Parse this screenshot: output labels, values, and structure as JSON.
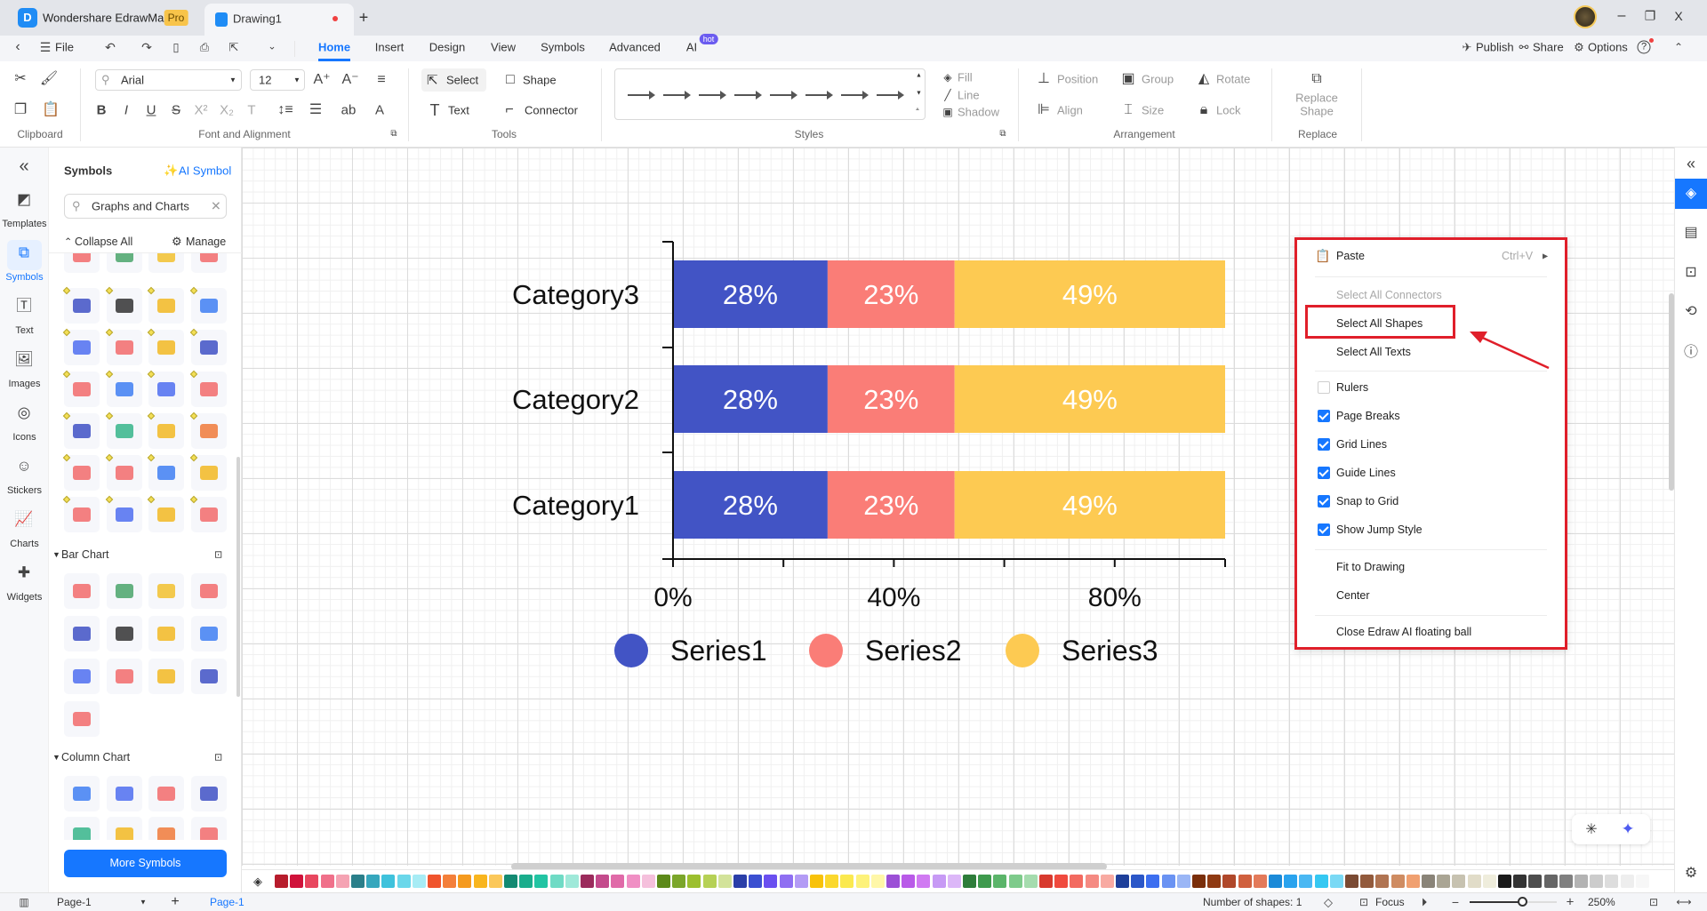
{
  "titlebar": {
    "app_name": "Wondershare EdrawMax",
    "pro_badge": "Pro",
    "doc_tab": "Drawing1",
    "new_tab": "+",
    "window": {
      "minimize": "–",
      "maximize": "❐",
      "close": "X"
    }
  },
  "menubar": {
    "file": "File",
    "tabs": [
      "Home",
      "Insert",
      "Design",
      "View",
      "Symbols",
      "Advanced",
      "AI"
    ],
    "active_tab": "Home",
    "hot_badge": "hot",
    "publish": "Publish",
    "share": "Share",
    "options": "Options",
    "help": "?"
  },
  "ribbon": {
    "groups": {
      "clipboard": "Clipboard",
      "font": "Font and Alignment",
      "tools": "Tools",
      "styles": "Styles",
      "arrangement": "Arrangement",
      "replace": "Replace"
    },
    "font_name": "Arial",
    "font_size": "12",
    "format_buttons": [
      "B",
      "I",
      "U",
      "S",
      "X²",
      "X₂",
      "T",
      "ab",
      "A"
    ],
    "tools": {
      "select": "Select",
      "shape": "Shape",
      "text": "Text",
      "connector": "Connector"
    },
    "style_props": {
      "fill": "Fill",
      "line": "Line",
      "shadow": "Shadow"
    },
    "arrangement": {
      "position": "Position",
      "group": "Group",
      "rotate": "Rotate",
      "align": "Align",
      "size": "Size",
      "lock": "Lock"
    },
    "replace_shape": [
      "Replace",
      "Shape"
    ]
  },
  "leftnav": {
    "items": [
      {
        "label": "Templates",
        "icon": "templates-icon"
      },
      {
        "label": "Symbols",
        "icon": "symbols-icon",
        "active": true
      },
      {
        "label": "Text",
        "icon": "text-icon"
      },
      {
        "label": "Images",
        "icon": "images-icon"
      },
      {
        "label": "Icons",
        "icon": "icons-icon"
      },
      {
        "label": "Stickers",
        "icon": "stickers-icon"
      },
      {
        "label": "Charts",
        "icon": "charts-icon"
      },
      {
        "label": "Widgets",
        "icon": "widgets-icon"
      }
    ]
  },
  "panel": {
    "title": "Symbols",
    "ai_symbol": "AI Symbol",
    "search_value": "Graphs and Charts",
    "collapse_all": "Collapse All",
    "manage": "Manage",
    "sections": [
      "Bar Chart",
      "Column Chart"
    ],
    "more_symbols": "More Symbols",
    "tile_colors": [
      "#f26b6b",
      "#4aa56a",
      "#f2c12e",
      "#f26b6b",
      "#3f51c4",
      "#333333",
      "#f2b822",
      "#3f7ff2",
      "#4f6ef0",
      "#f26b6b",
      "#f2b822",
      "#3f51c4",
      "#f26b6b",
      "#3f7ff2",
      "#4f6ef0",
      "#f26b6b",
      "#3f51c4",
      "#36b58a",
      "#f2b822",
      "#f07a3a",
      "#f26b6b",
      "#f26b6b",
      "#3f7ff2",
      "#f2b822",
      "#f26b6b",
      "#4f6ef0",
      "#f2b822",
      "#f26b6b"
    ]
  },
  "chart_data": {
    "type": "bar",
    "orientation": "horizontal",
    "stacked": true,
    "categories": [
      "Category1",
      "Category2",
      "Category3"
    ],
    "series": [
      {
        "name": "Series1",
        "values": [
          28,
          28,
          28
        ],
        "color": "#4254c5"
      },
      {
        "name": "Series2",
        "values": [
          23,
          23,
          23
        ],
        "color": "#fa7d77"
      },
      {
        "name": "Series3",
        "values": [
          49,
          49,
          49
        ],
        "color": "#fdca52"
      }
    ],
    "data_labels": true,
    "xlim": [
      0,
      100
    ],
    "x_ticks": [
      0,
      20,
      40,
      60,
      80,
      100
    ],
    "x_tick_labels": [
      "0%",
      "",
      "40%",
      "",
      "80%",
      ""
    ],
    "legend": "bottom",
    "grid": false
  },
  "context_menu": {
    "paste": "Paste",
    "paste_shortcut": "Ctrl+V",
    "select_items": [
      {
        "label": "Select All Connectors",
        "disabled": true
      },
      {
        "label": "Select All Shapes",
        "highlighted": true
      },
      {
        "label": "Select All Texts"
      }
    ],
    "toggles": [
      {
        "label": "Rulers",
        "checked": false
      },
      {
        "label": "Page Breaks",
        "checked": true
      },
      {
        "label": "Grid Lines",
        "checked": true
      },
      {
        "label": "Guide Lines",
        "checked": true
      },
      {
        "label": "Snap to Grid",
        "checked": true
      },
      {
        "label": "Show Jump Style",
        "checked": true
      }
    ],
    "view_items": [
      "Fit to Drawing",
      "Center"
    ],
    "close_ai": "Close Edraw AI floating ball",
    "highlight_color": "#e01f2a"
  },
  "palette": [
    "#b71c2c",
    "#d0123a",
    "#e8475f",
    "#f0708a",
    "#f5a3b3",
    "#2a7f8a",
    "#36a7bd",
    "#3fc2dc",
    "#6ad7ea",
    "#a7ecf5",
    "#f0542d",
    "#f47f3a",
    "#f59a1e",
    "#f8b51e",
    "#fbc85a",
    "#138a72",
    "#1aad8c",
    "#22c4a3",
    "#6fdbc5",
    "#9fe9d9",
    "#9b2b5c",
    "#c44b8c",
    "#e06aa8",
    "#f08fc4",
    "#f5c0dc",
    "#5d8a1a",
    "#7ba62a",
    "#9cbf2e",
    "#b6d155",
    "#d3e39a",
    "#2a3ea8",
    "#3b4fd1",
    "#6a4ff0",
    "#8f6ff2",
    "#b39bf5",
    "#f8c20a",
    "#fbd82e",
    "#fbe94f",
    "#fdf27a",
    "#fff7a8",
    "#9b4fd6",
    "#b95ae8",
    "#d07af2",
    "#c79af5",
    "#dcb7f8",
    "#2e7d3a",
    "#3e9a4d",
    "#5bb56a",
    "#7ecb8b",
    "#a5dcae",
    "#d83a2e",
    "#f04a3e",
    "#f36a60",
    "#f58a82",
    "#f8aaa2",
    "#1e3f9a",
    "#2b57c8",
    "#3d6ff0",
    "#6a93f3",
    "#9ab6f6",
    "#7a2e0a",
    "#8f3a12",
    "#b0482a",
    "#d0603e",
    "#e37a5a",
    "#1b8ad8",
    "#2aa3ee",
    "#4ab8f3",
    "#35c8f2",
    "#7ad9f5",
    "#7a4a33",
    "#925a3c",
    "#b07452",
    "#cf8c62",
    "#f0a070",
    "#8a8478",
    "#aaa594",
    "#c7c2b0",
    "#e1dcc8",
    "#efeddc",
    "#1a1a1a",
    "#333333",
    "#4d4d4d",
    "#666666",
    "#808080",
    "#b3b3b3",
    "#cccccc",
    "#dddddd",
    "#eeeeee",
    "#f7f7f7"
  ],
  "statusbar": {
    "page_dropdown": "Page-1",
    "add_page": "+",
    "page_tab": "Page-1",
    "shape_count": "Number of shapes: 1",
    "focus": "Focus",
    "zoom": "250%",
    "zoom_fraction": 0.6
  }
}
